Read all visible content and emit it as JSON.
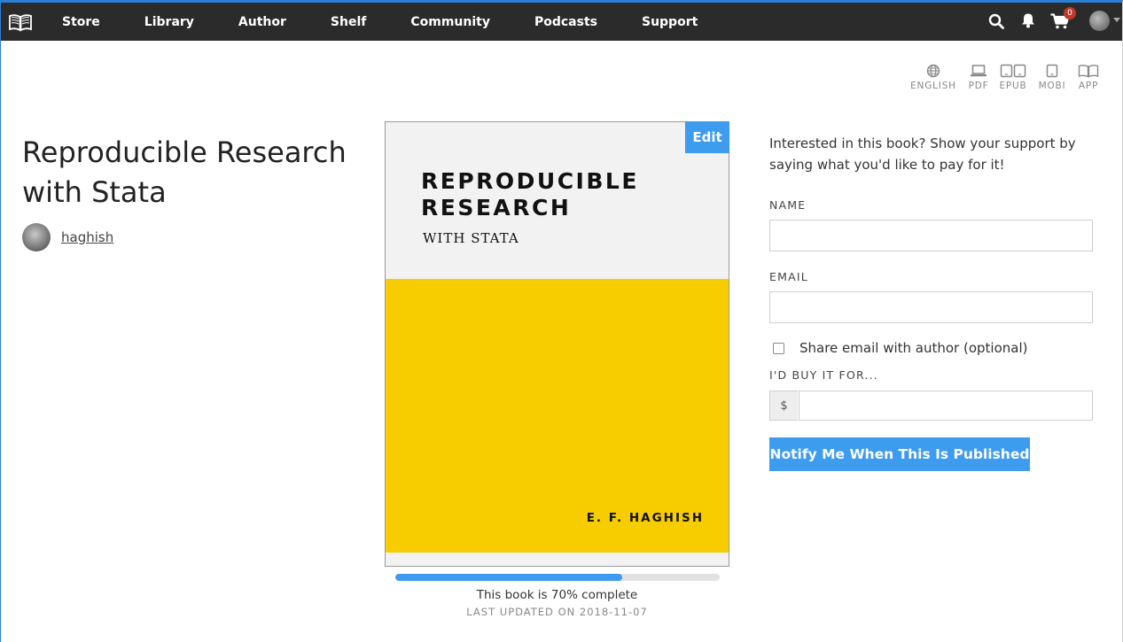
{
  "nav": {
    "logo_icon": "open-book-icon",
    "links": [
      "Store",
      "Library",
      "Author",
      "Shelf",
      "Community",
      "Podcasts",
      "Support"
    ],
    "cart_count": "0",
    "icons": [
      "search-icon",
      "bell-icon",
      "cart-icon",
      "avatar"
    ]
  },
  "formats": [
    {
      "label": "ENGLISH",
      "icon": "globe-icon"
    },
    {
      "label": "PDF",
      "icon": "laptop-icon"
    },
    {
      "label": "EPUB",
      "icon": "tablets-icon"
    },
    {
      "label": "MOBI",
      "icon": "tablet-icon"
    },
    {
      "label": "APP",
      "icon": "open-book-icon"
    }
  ],
  "book": {
    "title": "Reproducible Research with Stata",
    "author": "haghish",
    "cover": {
      "title_line1": "REPRODUCIBLE",
      "title_line2": "RESEARCH",
      "subtitle": "WITH STATA",
      "author": "E. F. HAGHISH"
    },
    "edit_label": "Edit",
    "progress_percent": 70,
    "progress_text": "This book is 70% complete",
    "last_updated": "LAST UPDATED ON 2018-11-07"
  },
  "form": {
    "intro": "Interested in this book? Show your support by saying what you'd like to pay for it!",
    "name_label": "NAME",
    "name_value": "",
    "email_label": "EMAIL",
    "email_value": "",
    "share_label": "Share email with author (optional)",
    "share_checked": false,
    "price_label": "I'D BUY IT FOR...",
    "currency": "$",
    "price_value": "",
    "notify_label": "Notify Me When This Is Published"
  },
  "colors": {
    "navbar": "#2b2b2b",
    "accent": "#3d9bf0",
    "cover_yellow": "#f8cd00",
    "cart_badge": "#c0392b"
  }
}
